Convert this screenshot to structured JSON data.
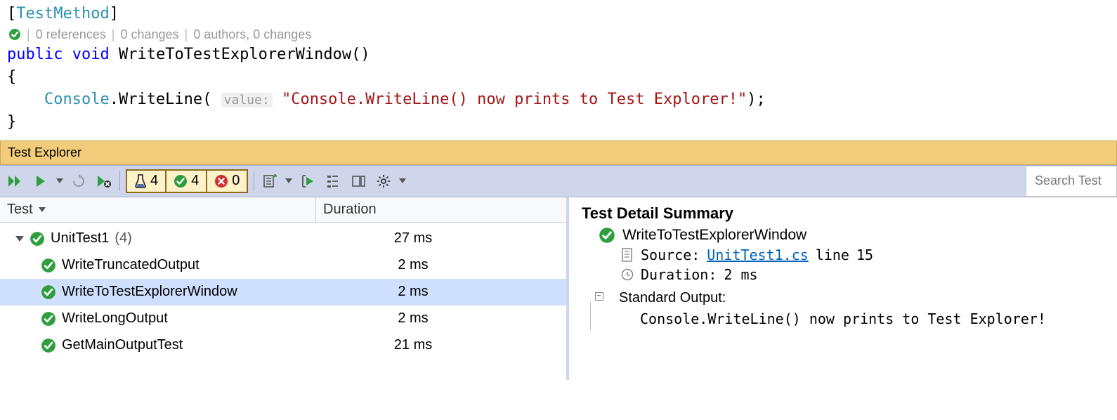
{
  "code": {
    "attribute_open": "[",
    "attribute_name": "TestMethod",
    "attribute_close": "]",
    "codelens": {
      "references": "0 references",
      "changes": "0 changes",
      "authors": "0 authors, 0 changes"
    },
    "sig_kw1": "public",
    "sig_kw2": "void",
    "sig_name": "WriteToTestExplorerWindow",
    "sig_parens": "()",
    "brace_open": "{",
    "call_type": "Console",
    "call_dot": ".",
    "call_method": "WriteLine",
    "call_open": "(",
    "param_hint": "value:",
    "string_literal": "\"Console.WriteLine() now prints to Test Explorer!\"",
    "call_close": ");",
    "brace_close": "}"
  },
  "panel": {
    "title": "Test Explorer"
  },
  "toolbar": {
    "counts": {
      "total": "4",
      "passed": "4",
      "failed": "0"
    },
    "search_placeholder": "Search Test"
  },
  "grid": {
    "col_test": "Test",
    "col_duration": "Duration",
    "group": {
      "name": "UnitTest1",
      "count_suffix": "(4)",
      "duration": "27 ms"
    },
    "rows": [
      {
        "name": "WriteTruncatedOutput",
        "duration": "2 ms",
        "selected": false
      },
      {
        "name": "WriteToTestExplorerWindow",
        "duration": "2 ms",
        "selected": true
      },
      {
        "name": "WriteLongOutput",
        "duration": "2 ms",
        "selected": false
      },
      {
        "name": "GetMainOutputTest",
        "duration": "21 ms",
        "selected": false
      }
    ]
  },
  "detail": {
    "title": "Test Detail Summary",
    "test_name": "WriteToTestExplorerWindow",
    "source_label": "Source:",
    "source_file": "UnitTest1.cs",
    "source_line_prefix": "line",
    "source_line": "15",
    "duration_label": "Duration:",
    "duration_value": "2 ms",
    "stdout_label": "Standard Output:",
    "stdout_value": "Console.WriteLine() now prints to Test Explorer!"
  }
}
